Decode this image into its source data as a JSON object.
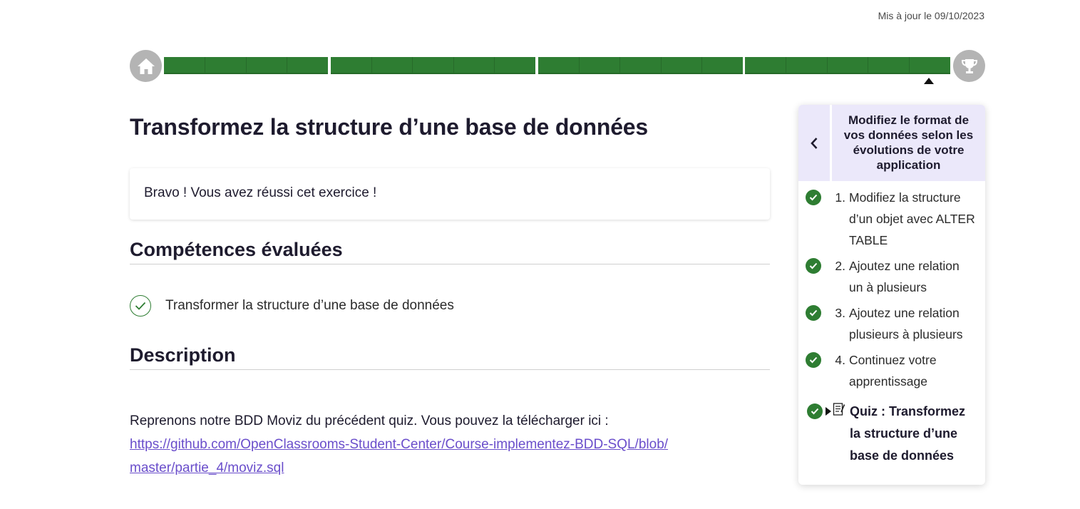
{
  "updated": "Mis à jour le 09/10/2023",
  "progress": {
    "segments": [
      4,
      5,
      5,
      5
    ],
    "home_icon": "home-icon",
    "trophy_icon": "trophy-icon",
    "color": "#2e7d32"
  },
  "page_title": "Transformez la structure d’une base de données",
  "result_message": "Bravo ! Vous avez réussi cet exercice !",
  "skills_heading": "Compétences évaluées",
  "skills": [
    "Transformer la structure d’une base de données"
  ],
  "description_heading": "Description",
  "description_text": "Reprenons notre BDD Moviz du précédent quiz. Vous pouvez la télécharger ici :",
  "description_link": "https://github.com/OpenClassrooms-Student-Center/Course-implementez-BDD-SQL/blob/master/partie_4/moviz.sql",
  "sidebar": {
    "title": "Modifiez le format de vos données selon les évolutions de votre application",
    "chapters": [
      {
        "num": "1.",
        "label": "Modifiez la structure d’un objet avec ALTER TABLE"
      },
      {
        "num": "2.",
        "label": "Ajoutez une relation un à plusieurs"
      },
      {
        "num": "3.",
        "label": "Ajoutez une relation plusieurs à plusieurs"
      },
      {
        "num": "4.",
        "label": "Continuez votre apprentissage"
      }
    ],
    "quiz_label": "Quiz : Transformez la structure d’une base de données"
  }
}
